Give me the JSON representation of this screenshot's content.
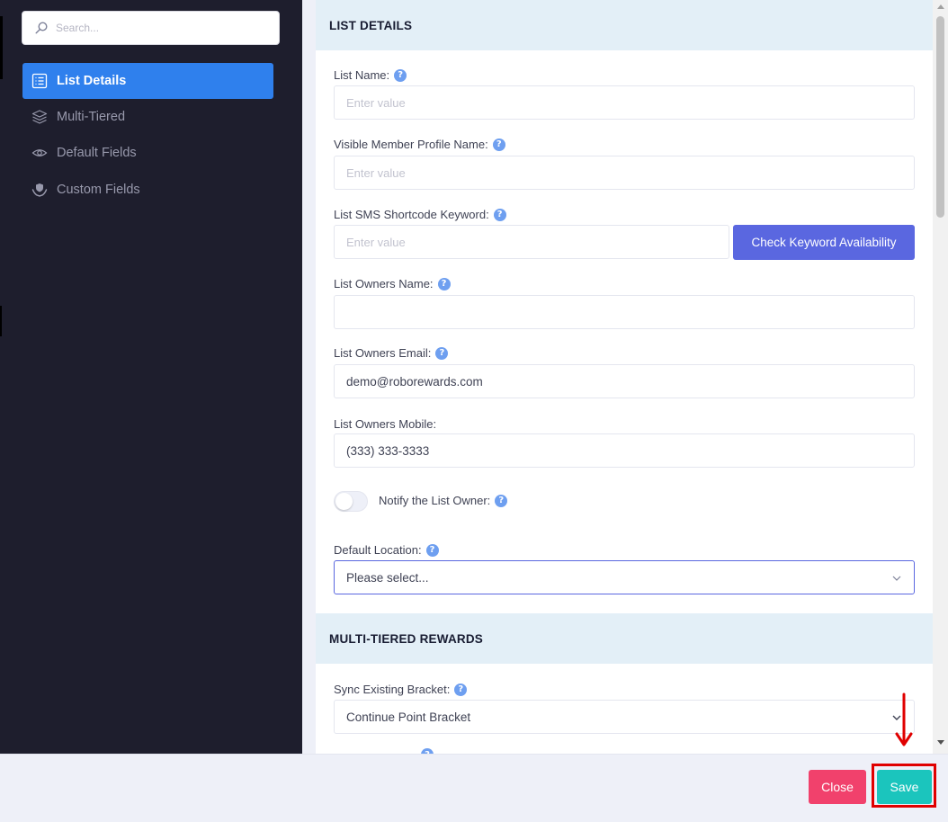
{
  "sidebar": {
    "search_placeholder": "Search...",
    "items": [
      {
        "label": "List Details",
        "icon": "list-icon",
        "active": true
      },
      {
        "label": "Multi-Tiered",
        "icon": "layers-icon",
        "active": false
      },
      {
        "label": "Default Fields",
        "icon": "eye-icon",
        "active": false
      },
      {
        "label": "Custom Fields",
        "icon": "hands-shield-icon",
        "active": false
      }
    ]
  },
  "list_details": {
    "header": "LIST DETAILS",
    "list_name": {
      "label": "List Name:",
      "placeholder": "Enter value",
      "value": ""
    },
    "visible_name": {
      "label": "Visible Member Profile Name:",
      "placeholder": "Enter value",
      "value": ""
    },
    "sms_keyword": {
      "label": "List SMS Shortcode Keyword:",
      "placeholder": "Enter value",
      "value": "",
      "button": "Check Keyword Availability"
    },
    "owners_name": {
      "label": "List Owners Name:",
      "value": ""
    },
    "owners_email": {
      "label": "List Owners Email:",
      "value": "demo@roborewards.com"
    },
    "owners_mobile": {
      "label": "List Owners Mobile:",
      "value": "(333) 333-3333"
    },
    "notify": {
      "label": "Notify the List Owner:",
      "on": false
    },
    "default_location": {
      "label": "Default Location:",
      "selected": "Please select..."
    }
  },
  "multi_tiered": {
    "header": "MULTI-TIERED REWARDS",
    "sync_bracket": {
      "label": "Sync Existing Bracket:",
      "selected": "Continue Point Bracket"
    }
  },
  "footer": {
    "close": "Close",
    "save": "Save"
  },
  "colors": {
    "sidebar_bg": "#1e1e2d",
    "active_nav": "#2f80ed",
    "check_button": "#5a67e0",
    "close_button": "#f1416c",
    "save_button": "#1bc5bd",
    "highlight": "#e00000"
  }
}
